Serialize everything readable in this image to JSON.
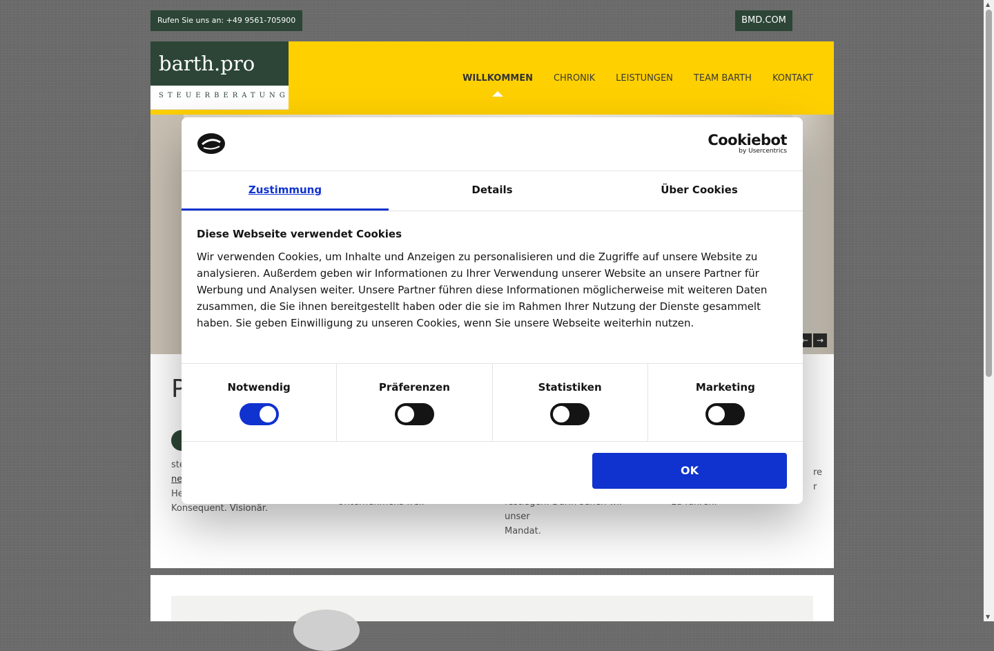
{
  "topbar": {
    "phone": "Rufen Sie uns an: +49 9561-705900",
    "site_link": "BMD.COM"
  },
  "logo": {
    "name": "barth.pro",
    "tagline": "STEUERBERATUNG"
  },
  "nav": {
    "items": [
      {
        "label": "WILLKOMMEN",
        "active": true
      },
      {
        "label": "CHRONIK"
      },
      {
        "label": "LEISTUNGEN"
      },
      {
        "label": "TEAM BARTH"
      },
      {
        "label": "KONTAKT"
      }
    ]
  },
  "hero": {
    "prev": "←",
    "next": "→"
  },
  "content": {
    "heading": "P",
    "col1_a": "ste",
    "col1_link": "ne",
    "col1_b": "He",
    "col1_c": "Konsequent. Visionär.",
    "col2": "Unternehmens frei.",
    "col3_a": "festlegen: Darin sehen wir unser",
    "col3_b": "Mandat.",
    "col4_a": "re",
    "col4_b": "r",
    "col4_c": "zu führen."
  },
  "cookie": {
    "brand": "Cookiebot",
    "brand_sub": "by Usercentrics",
    "tabs": [
      {
        "label": "Zustimmung",
        "active": true
      },
      {
        "label": "Details"
      },
      {
        "label": "Über Cookies"
      }
    ],
    "title": "Diese Webseite verwendet Cookies",
    "text": "Wir verwenden Cookies, um Inhalte und Anzeigen zu personalisieren und die Zugriffe auf unsere Website zu analysieren. Außerdem geben wir Informationen zu Ihrer Verwendung unserer Website an unsere Partner für Werbung und Analysen weiter. Unsere Partner führen diese Informationen möglicherweise mit weiteren Daten zusammen, die Sie ihnen bereitgestellt haben oder die sie im Rahmen Ihrer Nutzung der Dienste gesammelt haben. Sie geben Einwilligung zu unseren Cookies, wenn Sie unsere Webseite weiterhin nutzen.",
    "toggles": [
      {
        "label": "Notwendig",
        "on": true
      },
      {
        "label": "Präferenzen",
        "on": false
      },
      {
        "label": "Statistiken",
        "on": false
      },
      {
        "label": "Marketing",
        "on": false
      }
    ],
    "ok_label": "OK",
    "accent": "#1032cf"
  },
  "colors": {
    "brand_green": "#2c4536",
    "header_yellow": "#ffd000"
  }
}
